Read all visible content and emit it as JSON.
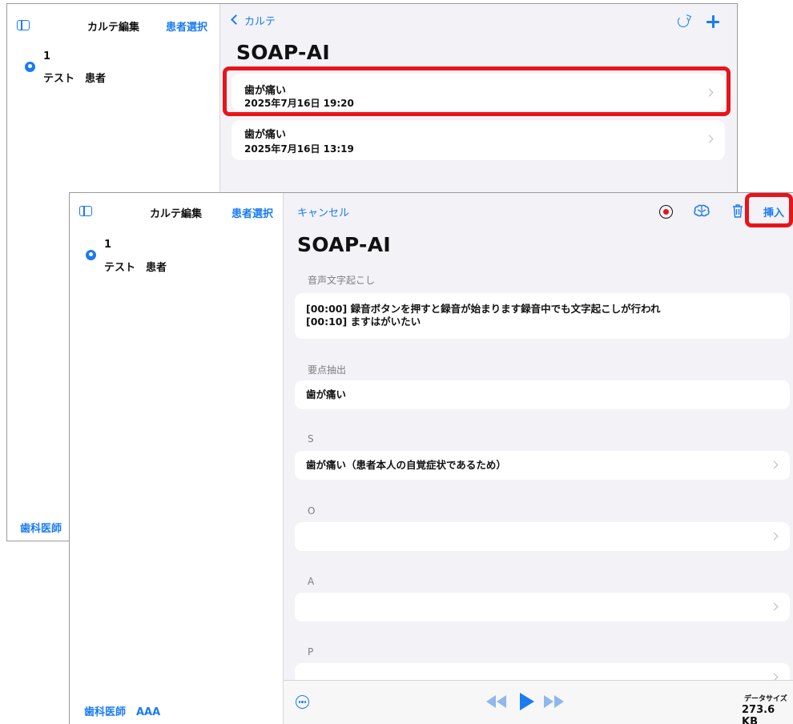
{
  "back_window": {
    "sidebar": {
      "title": "カルテ編集",
      "patient_select": "患者選択",
      "patient_no": "1",
      "patient_name": "テスト　患者",
      "footer": "歯科医師"
    },
    "nav": {
      "back_label": "カルテ",
      "title": "SOAP-AI"
    },
    "records": [
      {
        "title": "歯が痛い",
        "datetime": "2025年7月16日 19:20"
      },
      {
        "title": "歯が痛い",
        "datetime": "2025年7月16日 13:19"
      }
    ]
  },
  "front_window": {
    "sidebar": {
      "title": "カルテ編集",
      "patient_select": "患者選択",
      "patient_no": "1",
      "patient_name": "テスト　患者",
      "footer": "歯科医師　AAA"
    },
    "nav": {
      "cancel_label": "キャンセル",
      "insert_label": "挿入",
      "title": "SOAP-AI"
    },
    "sections": {
      "transcript_label": "音声文字起こし",
      "transcript_lines": [
        "[00:00] 録音ボタンを押すと録音が始まります録音中でも文字起こしが行われ",
        "[00:10] ますはがいたい"
      ],
      "summary_label": "要点抽出",
      "summary_value": "歯が痛い",
      "s_label": "S",
      "s_value": "歯が痛い（患者本人の自覚症状であるため）",
      "o_label": "O",
      "o_value": "",
      "a_label": "A",
      "a_value": "",
      "p_label": "P",
      "p_value": ""
    },
    "toolbar": {
      "data_size_label": "データサイズ",
      "data_size_value": "273.6 KB"
    }
  },
  "colors": {
    "accent": "#1a7bf2",
    "highlight": "#e8141c",
    "background": "#f2f2f7"
  },
  "icons": [
    "sidebar-toggle-icon",
    "patient-icon",
    "back-chevron-icon",
    "refresh-icon",
    "plus-icon",
    "chevron-right-icon",
    "record-icon",
    "brain-icon",
    "trash-icon",
    "more-icon",
    "rewind-icon",
    "play-icon",
    "fast-forward-icon"
  ]
}
